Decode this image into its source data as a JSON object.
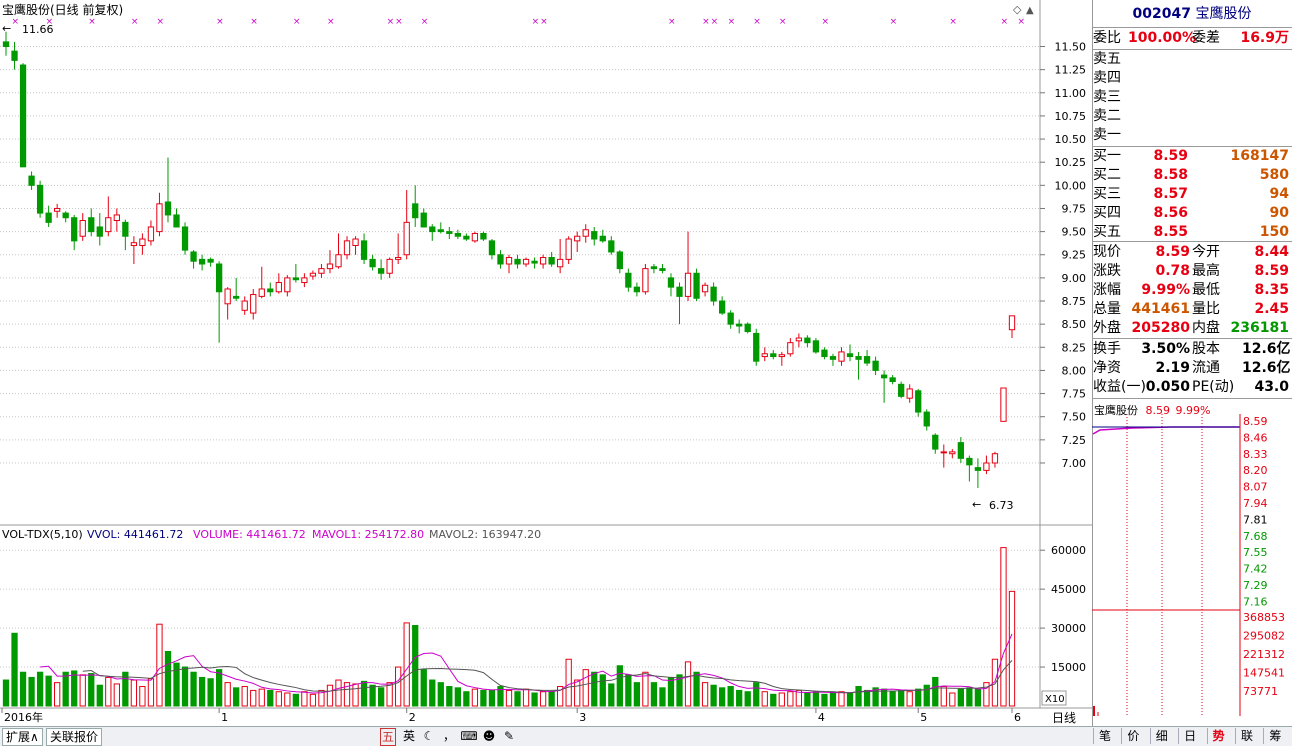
{
  "chart_header": {
    "title": "宝鹰股份(日线 前复权)",
    "max_price_label": "11.66",
    "min_price_label": "6.73",
    "period_label": "日线",
    "x_axis_labels": [
      {
        "label": "2016年"
      },
      {
        "label": "1"
      },
      {
        "label": "2"
      },
      {
        "label": "3"
      },
      {
        "label": "4"
      },
      {
        "label": "5"
      },
      {
        "label": "6"
      }
    ],
    "price_ticks": [
      "11.50",
      "11.25",
      "11.00",
      "10.75",
      "10.50",
      "10.25",
      "10.00",
      "9.75",
      "9.50",
      "9.25",
      "9.00",
      "8.75",
      "8.50",
      "8.25",
      "8.00",
      "7.75",
      "7.50",
      "7.25",
      "7.00"
    ],
    "vol_ticks": [
      "60000",
      "45000",
      "30000",
      "15000"
    ],
    "vol_unit": "X10"
  },
  "volume_header": {
    "indicator": "VOL-TDX(5,10)",
    "vvol": "VVOL: 441461.72",
    "volume": "VOLUME: 441461.72",
    "mavol1": "MAVOL1: 254172.80",
    "mavol2": "MAVOL2: 163947.20"
  },
  "colors": {
    "up": "#e60012",
    "down": "#009900",
    "ma1": "#cc00cc",
    "ma2": "#555555",
    "grid": "#c8c8c8",
    "navy": "#000080"
  },
  "chart_data": {
    "type": "candlestick",
    "ylim": [
      6.6,
      11.7
    ],
    "vol_ylim": [
      0,
      62000
    ],
    "candles": [
      {
        "o": 11.55,
        "h": 11.66,
        "l": 11.4,
        "c": 11.5,
        "v": 10000
      },
      {
        "o": 11.45,
        "h": 11.55,
        "l": 11.25,
        "c": 11.35,
        "v": 28000
      },
      {
        "o": 11.3,
        "h": 11.32,
        "l": 10.25,
        "c": 10.2,
        "v": 13000
      },
      {
        "o": 10.1,
        "h": 10.15,
        "l": 9.95,
        "c": 10.0,
        "v": 11000
      },
      {
        "o": 10.0,
        "h": 10.05,
        "l": 9.65,
        "c": 9.7,
        "v": 13000
      },
      {
        "o": 9.7,
        "h": 9.78,
        "l": 9.55,
        "c": 9.6,
        "v": 11500
      },
      {
        "o": 9.72,
        "h": 9.8,
        "l": 9.65,
        "c": 9.75,
        "v": 9000
      },
      {
        "o": 9.7,
        "h": 9.72,
        "l": 9.6,
        "c": 9.65,
        "v": 13000
      },
      {
        "o": 9.65,
        "h": 9.68,
        "l": 9.3,
        "c": 9.4,
        "v": 13500
      },
      {
        "o": 9.45,
        "h": 9.7,
        "l": 9.4,
        "c": 9.62,
        "v": 12000
      },
      {
        "o": 9.65,
        "h": 9.75,
        "l": 9.45,
        "c": 9.5,
        "v": 12500
      },
      {
        "o": 9.55,
        "h": 9.7,
        "l": 9.35,
        "c": 9.45,
        "v": 8000
      },
      {
        "o": 9.5,
        "h": 9.88,
        "l": 9.45,
        "c": 9.65,
        "v": 11000
      },
      {
        "o": 9.62,
        "h": 9.75,
        "l": 9.5,
        "c": 9.68,
        "v": 8500
      },
      {
        "o": 9.6,
        "h": 9.63,
        "l": 9.3,
        "c": 9.45,
        "v": 13000
      },
      {
        "o": 9.35,
        "h": 9.45,
        "l": 9.15,
        "c": 9.38,
        "v": 10000
      },
      {
        "o": 9.35,
        "h": 9.48,
        "l": 9.25,
        "c": 9.42,
        "v": 7500
      },
      {
        "o": 9.4,
        "h": 9.62,
        "l": 9.35,
        "c": 9.55,
        "v": 10500
      },
      {
        "o": 9.5,
        "h": 9.92,
        "l": 9.45,
        "c": 9.8,
        "v": 31500
      },
      {
        "o": 9.82,
        "h": 10.3,
        "l": 9.6,
        "c": 9.68,
        "v": 21000
      },
      {
        "o": 9.68,
        "h": 9.75,
        "l": 9.55,
        "c": 9.55,
        "v": 16500
      },
      {
        "o": 9.55,
        "h": 9.6,
        "l": 9.25,
        "c": 9.3,
        "v": 15000
      },
      {
        "o": 9.28,
        "h": 9.3,
        "l": 9.1,
        "c": 9.18,
        "v": 13000
      },
      {
        "o": 9.2,
        "h": 9.25,
        "l": 9.08,
        "c": 9.15,
        "v": 11000
      },
      {
        "o": 9.2,
        "h": 9.22,
        "l": 9.12,
        "c": 9.17,
        "v": 10500
      },
      {
        "o": 9.15,
        "h": 9.18,
        "l": 8.3,
        "c": 8.85,
        "v": 14000
      },
      {
        "o": 8.72,
        "h": 8.9,
        "l": 8.55,
        "c": 8.88,
        "v": 9000
      },
      {
        "o": 8.8,
        "h": 9.0,
        "l": 8.75,
        "c": 8.78,
        "v": 7000
      },
      {
        "o": 8.65,
        "h": 8.8,
        "l": 8.6,
        "c": 8.75,
        "v": 7500
      },
      {
        "o": 8.62,
        "h": 8.88,
        "l": 8.55,
        "c": 8.82,
        "v": 6000
      },
      {
        "o": 8.8,
        "h": 9.12,
        "l": 8.78,
        "c": 8.88,
        "v": 6500
      },
      {
        "o": 8.88,
        "h": 8.95,
        "l": 8.8,
        "c": 8.85,
        "v": 6000
      },
      {
        "o": 8.85,
        "h": 9.05,
        "l": 8.83,
        "c": 8.95,
        "v": 5500
      },
      {
        "o": 8.85,
        "h": 9.03,
        "l": 8.8,
        "c": 9.0,
        "v": 5000
      },
      {
        "o": 9.0,
        "h": 9.15,
        "l": 8.95,
        "c": 8.98,
        "v": 4500
      },
      {
        "o": 8.95,
        "h": 9.05,
        "l": 8.9,
        "c": 9.0,
        "v": 5500
      },
      {
        "o": 9.02,
        "h": 9.08,
        "l": 8.98,
        "c": 9.05,
        "v": 4500
      },
      {
        "o": 9.05,
        "h": 9.15,
        "l": 9.0,
        "c": 9.1,
        "v": 6000
      },
      {
        "o": 9.1,
        "h": 9.3,
        "l": 9.05,
        "c": 9.15,
        "v": 8000
      },
      {
        "o": 9.12,
        "h": 9.48,
        "l": 9.1,
        "c": 9.25,
        "v": 10000
      },
      {
        "o": 9.25,
        "h": 9.45,
        "l": 9.2,
        "c": 9.4,
        "v": 9000
      },
      {
        "o": 9.35,
        "h": 9.45,
        "l": 9.25,
        "c": 9.42,
        "v": 8500
      },
      {
        "o": 9.4,
        "h": 9.48,
        "l": 9.15,
        "c": 9.2,
        "v": 9500
      },
      {
        "o": 9.2,
        "h": 9.25,
        "l": 9.08,
        "c": 9.12,
        "v": 8000
      },
      {
        "o": 9.1,
        "h": 9.2,
        "l": 8.98,
        "c": 9.05,
        "v": 7000
      },
      {
        "o": 9.05,
        "h": 9.22,
        "l": 9.0,
        "c": 9.2,
        "v": 9000
      },
      {
        "o": 9.2,
        "h": 9.48,
        "l": 9.15,
        "c": 9.22,
        "v": 15000
      },
      {
        "o": 9.25,
        "h": 9.95,
        "l": 9.2,
        "c": 9.6,
        "v": 32000
      },
      {
        "o": 9.8,
        "h": 10.0,
        "l": 9.55,
        "c": 9.65,
        "v": 31000
      },
      {
        "o": 9.7,
        "h": 9.75,
        "l": 9.55,
        "c": 9.55,
        "v": 14000
      },
      {
        "o": 9.55,
        "h": 9.58,
        "l": 9.4,
        "c": 9.5,
        "v": 10000
      },
      {
        "o": 9.52,
        "h": 9.6,
        "l": 9.48,
        "c": 9.5,
        "v": 9000
      },
      {
        "o": 9.5,
        "h": 9.55,
        "l": 9.42,
        "c": 9.48,
        "v": 7500
      },
      {
        "o": 9.48,
        "h": 9.52,
        "l": 9.42,
        "c": 9.45,
        "v": 7000
      },
      {
        "o": 9.45,
        "h": 9.48,
        "l": 9.4,
        "c": 9.42,
        "v": 5500
      },
      {
        "o": 9.4,
        "h": 9.5,
        "l": 9.38,
        "c": 9.48,
        "v": 6500
      },
      {
        "o": 9.48,
        "h": 9.5,
        "l": 9.4,
        "c": 9.42,
        "v": 6000
      },
      {
        "o": 9.4,
        "h": 9.42,
        "l": 9.2,
        "c": 9.25,
        "v": 6000
      },
      {
        "o": 9.25,
        "h": 9.3,
        "l": 9.1,
        "c": 9.15,
        "v": 7500
      },
      {
        "o": 9.15,
        "h": 9.25,
        "l": 9.05,
        "c": 9.22,
        "v": 6000
      },
      {
        "o": 9.2,
        "h": 9.25,
        "l": 9.1,
        "c": 9.15,
        "v": 5500
      },
      {
        "o": 9.15,
        "h": 9.22,
        "l": 9.12,
        "c": 9.2,
        "v": 6500
      },
      {
        "o": 9.18,
        "h": 9.22,
        "l": 9.1,
        "c": 9.16,
        "v": 5000
      },
      {
        "o": 9.15,
        "h": 9.25,
        "l": 9.1,
        "c": 9.22,
        "v": 5500
      },
      {
        "o": 9.22,
        "h": 9.28,
        "l": 9.12,
        "c": 9.15,
        "v": 5500
      },
      {
        "o": 9.12,
        "h": 9.42,
        "l": 9.05,
        "c": 9.2,
        "v": 7500
      },
      {
        "o": 9.2,
        "h": 9.45,
        "l": 9.15,
        "c": 9.42,
        "v": 18000
      },
      {
        "o": 9.4,
        "h": 9.5,
        "l": 9.28,
        "c": 9.45,
        "v": 10000
      },
      {
        "o": 9.45,
        "h": 9.58,
        "l": 9.38,
        "c": 9.52,
        "v": 14000
      },
      {
        "o": 9.5,
        "h": 9.55,
        "l": 9.35,
        "c": 9.42,
        "v": 13000
      },
      {
        "o": 9.45,
        "h": 9.52,
        "l": 9.38,
        "c": 9.4,
        "v": 12000
      },
      {
        "o": 9.4,
        "h": 9.45,
        "l": 9.25,
        "c": 9.28,
        "v": 8500
      },
      {
        "o": 9.28,
        "h": 9.3,
        "l": 9.05,
        "c": 9.1,
        "v": 15500
      },
      {
        "o": 9.05,
        "h": 9.1,
        "l": 8.85,
        "c": 8.9,
        "v": 12000
      },
      {
        "o": 8.9,
        "h": 8.95,
        "l": 8.8,
        "c": 8.85,
        "v": 9000
      },
      {
        "o": 8.85,
        "h": 9.15,
        "l": 8.82,
        "c": 9.1,
        "v": 13000
      },
      {
        "o": 9.12,
        "h": 9.15,
        "l": 9.05,
        "c": 9.1,
        "v": 9000
      },
      {
        "o": 9.1,
        "h": 9.15,
        "l": 9.05,
        "c": 9.08,
        "v": 7000
      },
      {
        "o": 9.0,
        "h": 9.05,
        "l": 8.8,
        "c": 8.9,
        "v": 11000
      },
      {
        "o": 8.9,
        "h": 8.95,
        "l": 8.5,
        "c": 8.8,
        "v": 12000
      },
      {
        "o": 8.8,
        "h": 9.5,
        "l": 8.75,
        "c": 9.05,
        "v": 17000
      },
      {
        "o": 9.05,
        "h": 9.1,
        "l": 8.75,
        "c": 8.78,
        "v": 13000
      },
      {
        "o": 8.85,
        "h": 8.95,
        "l": 8.8,
        "c": 8.92,
        "v": 9000
      },
      {
        "o": 8.9,
        "h": 8.95,
        "l": 8.7,
        "c": 8.75,
        "v": 8000
      },
      {
        "o": 8.75,
        "h": 8.8,
        "l": 8.6,
        "c": 8.62,
        "v": 7000
      },
      {
        "o": 8.62,
        "h": 8.65,
        "l": 8.45,
        "c": 8.5,
        "v": 7500
      },
      {
        "o": 8.5,
        "h": 8.55,
        "l": 8.4,
        "c": 8.48,
        "v": 6000
      },
      {
        "o": 8.5,
        "h": 8.52,
        "l": 8.4,
        "c": 8.42,
        "v": 5500
      },
      {
        "o": 8.4,
        "h": 8.45,
        "l": 8.05,
        "c": 8.1,
        "v": 9000
      },
      {
        "o": 8.15,
        "h": 8.25,
        "l": 8.1,
        "c": 8.18,
        "v": 5500
      },
      {
        "o": 8.18,
        "h": 8.22,
        "l": 8.12,
        "c": 8.15,
        "v": 4500
      },
      {
        "o": 8.15,
        "h": 8.2,
        "l": 8.05,
        "c": 8.17,
        "v": 5000
      },
      {
        "o": 8.18,
        "h": 8.35,
        "l": 8.15,
        "c": 8.3,
        "v": 5500
      },
      {
        "o": 8.32,
        "h": 8.4,
        "l": 8.25,
        "c": 8.35,
        "v": 6000
      },
      {
        "o": 8.35,
        "h": 8.38,
        "l": 8.25,
        "c": 8.3,
        "v": 5000
      },
      {
        "o": 8.32,
        "h": 8.35,
        "l": 8.18,
        "c": 8.2,
        "v": 5500
      },
      {
        "o": 8.22,
        "h": 8.25,
        "l": 8.12,
        "c": 8.15,
        "v": 4500
      },
      {
        "o": 8.15,
        "h": 8.18,
        "l": 8.05,
        "c": 8.12,
        "v": 5000
      },
      {
        "o": 8.1,
        "h": 8.25,
        "l": 8.05,
        "c": 8.2,
        "v": 5500
      },
      {
        "o": 8.18,
        "h": 8.28,
        "l": 8.1,
        "c": 8.15,
        "v": 5000
      },
      {
        "o": 8.15,
        "h": 8.2,
        "l": 7.9,
        "c": 8.12,
        "v": 7500
      },
      {
        "o": 8.15,
        "h": 8.22,
        "l": 8.05,
        "c": 8.08,
        "v": 6000
      },
      {
        "o": 8.1,
        "h": 8.15,
        "l": 7.95,
        "c": 8.0,
        "v": 7000
      },
      {
        "o": 7.95,
        "h": 8.0,
        "l": 7.65,
        "c": 7.92,
        "v": 6500
      },
      {
        "o": 7.92,
        "h": 7.95,
        "l": 7.85,
        "c": 7.88,
        "v": 5500
      },
      {
        "o": 7.85,
        "h": 7.88,
        "l": 7.7,
        "c": 7.72,
        "v": 6000
      },
      {
        "o": 7.7,
        "h": 7.85,
        "l": 7.65,
        "c": 7.8,
        "v": 5500
      },
      {
        "o": 7.78,
        "h": 7.8,
        "l": 7.5,
        "c": 7.55,
        "v": 6500
      },
      {
        "o": 7.55,
        "h": 7.58,
        "l": 7.35,
        "c": 7.4,
        "v": 8000
      },
      {
        "o": 7.3,
        "h": 7.32,
        "l": 7.1,
        "c": 7.15,
        "v": 11000
      },
      {
        "o": 7.12,
        "h": 7.2,
        "l": 6.95,
        "c": 7.12,
        "v": 7500
      },
      {
        "o": 7.1,
        "h": 7.15,
        "l": 7.05,
        "c": 7.12,
        "v": 5000
      },
      {
        "o": 7.22,
        "h": 7.28,
        "l": 7.0,
        "c": 7.05,
        "v": 6500
      },
      {
        "o": 7.05,
        "h": 7.08,
        "l": 6.8,
        "c": 6.98,
        "v": 7000
      },
      {
        "o": 6.95,
        "h": 7.05,
        "l": 6.73,
        "c": 6.92,
        "v": 6500
      },
      {
        "o": 6.92,
        "h": 7.08,
        "l": 6.88,
        "c": 7.0,
        "v": 9000
      },
      {
        "o": 7.0,
        "h": 7.12,
        "l": 6.95,
        "c": 7.1,
        "v": 18000
      },
      {
        "o": 7.45,
        "h": 7.81,
        "l": 7.45,
        "c": 7.81,
        "v": 61000
      },
      {
        "o": 8.44,
        "h": 8.59,
        "l": 8.35,
        "c": 8.59,
        "v": 44146
      }
    ]
  },
  "quote": {
    "code": "002047",
    "name": "宝鹰股份",
    "weibi_label": "委比",
    "weibi": "100.00%",
    "weicha_label": "委差",
    "weicha": "16.9万",
    "sell": [
      {
        "label": "卖五"
      },
      {
        "label": "卖四"
      },
      {
        "label": "卖三"
      },
      {
        "label": "卖二"
      },
      {
        "label": "卖一"
      }
    ],
    "buy": [
      {
        "label": "买一",
        "price": "8.59",
        "vol": "168147"
      },
      {
        "label": "买二",
        "price": "8.58",
        "vol": "580"
      },
      {
        "label": "买三",
        "price": "8.57",
        "vol": "94"
      },
      {
        "label": "买四",
        "price": "8.56",
        "vol": "90"
      },
      {
        "label": "买五",
        "price": "8.55",
        "vol": "150"
      }
    ],
    "stats": [
      {
        "l1": "现价",
        "v1": "8.59",
        "l2": "今开",
        "v2": "8.44",
        "c1": "red",
        "c2": "red"
      },
      {
        "l1": "涨跌",
        "v1": "0.78",
        "l2": "最高",
        "v2": "8.59",
        "c1": "red",
        "c2": "red"
      },
      {
        "l1": "涨幅",
        "v1": "9.99%",
        "l2": "最低",
        "v2": "8.35",
        "c1": "red",
        "c2": "red"
      },
      {
        "l1": "总量",
        "v1": "441461",
        "l2": "量比",
        "v2": "2.45",
        "c1": "orange",
        "c2": "red"
      },
      {
        "l1": "外盘",
        "v1": "205280",
        "l2": "内盘",
        "v2": "236181",
        "c1": "red",
        "c2": "green"
      }
    ],
    "fund": [
      {
        "l1": "换手",
        "v1": "3.50%",
        "l2": "股本",
        "v2": "12.6亿"
      },
      {
        "l1": "净资",
        "v1": "2.19",
        "l2": "流通",
        "v2": "12.6亿"
      },
      {
        "l1": "收益(一)",
        "v1": "0.050",
        "l2": "PE(动)",
        "v2": "43.0"
      }
    ],
    "mini": {
      "name": "宝鹰股份",
      "price": "8.59",
      "pct": "9.99%",
      "price_levels": [
        "8.59",
        "8.46",
        "8.33",
        "8.20",
        "8.07",
        "7.94",
        "7.81",
        "7.68",
        "7.55",
        "7.42",
        "7.29",
        "7.16"
      ],
      "vol_levels": [
        "368853",
        "295082",
        "221312",
        "147541",
        "73771"
      ]
    }
  },
  "bottom": {
    "left_tabs": [
      "扩展∧",
      "关联报价"
    ],
    "tools": [
      "五",
      "英",
      "☾",
      "，",
      "⌨",
      "☻",
      "✎"
    ],
    "right_tabs": [
      "笔",
      "价",
      "细",
      "日",
      "势",
      "联",
      "筹"
    ]
  }
}
